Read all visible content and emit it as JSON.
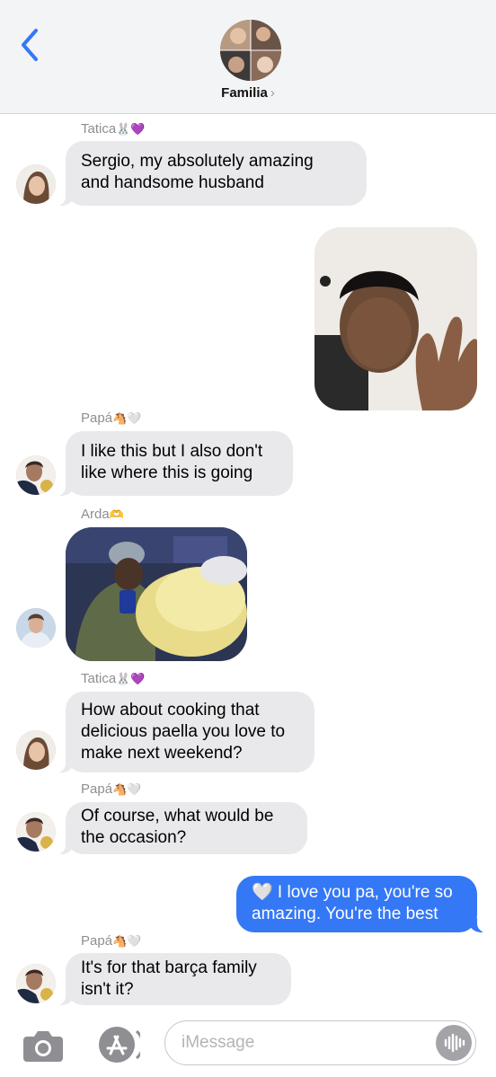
{
  "header": {
    "title": "Familia",
    "chevron": "›"
  },
  "colors": {
    "accent": "#3478f6",
    "incoming_bubble": "#e9e9eb",
    "sender_label": "#8e8e93"
  },
  "messages": [
    {
      "sender": "Tatica",
      "sender_emoji": "🐰💜",
      "direction": "incoming",
      "type": "text",
      "text": "Sergio, my absolutely amazing\nand handsome husband"
    },
    {
      "direction": "outgoing",
      "type": "photo"
    },
    {
      "sender": "Papá",
      "sender_emoji": "🐴🤍",
      "direction": "incoming",
      "type": "text",
      "text": "I like this but I also don't\nlike where this is going"
    },
    {
      "sender": "Arda",
      "sender_emoji": "🫶",
      "direction": "incoming",
      "type": "photo"
    },
    {
      "sender": "Tatica",
      "sender_emoji": "🐰💜",
      "direction": "incoming",
      "type": "text",
      "text": "How about cooking that\ndelicious paella you love to\nmake next weekend?"
    },
    {
      "sender": "Papá",
      "sender_emoji": "🐴🤍",
      "direction": "incoming",
      "type": "text",
      "text": "Of course, what would be\nthe occasion?"
    },
    {
      "direction": "outgoing",
      "type": "text",
      "text": "🤍 I love you pa, you're so\namazing. You're the best"
    },
    {
      "sender": "Papá",
      "sender_emoji": "🐴🤍",
      "direction": "incoming",
      "type": "text",
      "text": "It's for that barça family\nisn't it?"
    }
  ],
  "input_bar": {
    "placeholder": "iMessage",
    "icons": [
      "camera-icon",
      "app-store-icon",
      "audio-waveform-icon"
    ]
  }
}
